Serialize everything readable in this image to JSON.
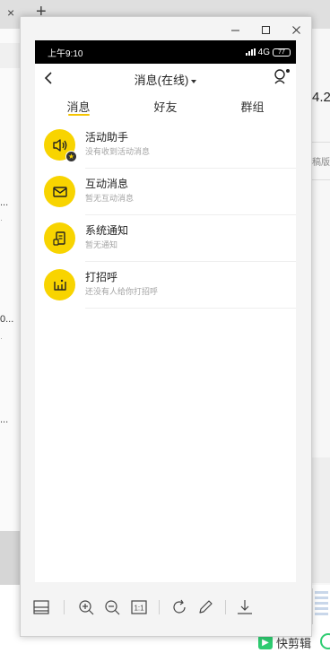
{
  "background": {
    "tab_close": "×",
    "tab_new": "+",
    "right_big_text": "4.2",
    "right_small_text": "稿版",
    "left_texts": [
      "...",
      "0...",
      "..."
    ],
    "kuaijian_label": "快剪辑",
    "kuaijian_logo": "▶"
  },
  "viewer": {
    "controls": {
      "minimize": "minimize-icon",
      "maximize": "maximize-icon",
      "close": "close-icon"
    },
    "toolbar_icons": [
      "layout-icon",
      "zoom-in-icon",
      "zoom-out-icon",
      "actual-size-icon",
      "rotate-icon",
      "edit-icon",
      "download-icon"
    ],
    "actual_size_label": "1:1"
  },
  "phone": {
    "status": {
      "time": "上午9:10",
      "network": "4G",
      "battery": "77"
    },
    "nav": {
      "title": "消息(在线)"
    },
    "tabs": [
      {
        "label": "消息",
        "active": true
      },
      {
        "label": "好友",
        "active": false
      },
      {
        "label": "群组",
        "active": false
      }
    ],
    "items": [
      {
        "title": "活动助手",
        "subtitle": "没有收到活动消息",
        "icon": "speaker-icon"
      },
      {
        "title": "互动消息",
        "subtitle": "暂无互动消息",
        "icon": "envelope-icon"
      },
      {
        "title": "系统通知",
        "subtitle": "暂无通知",
        "icon": "notice-icon"
      },
      {
        "title": "打招呼",
        "subtitle": "还没有人给你打招呼",
        "icon": "wave-icon"
      }
    ],
    "badge": "★",
    "accent_color": "#f8d400"
  }
}
